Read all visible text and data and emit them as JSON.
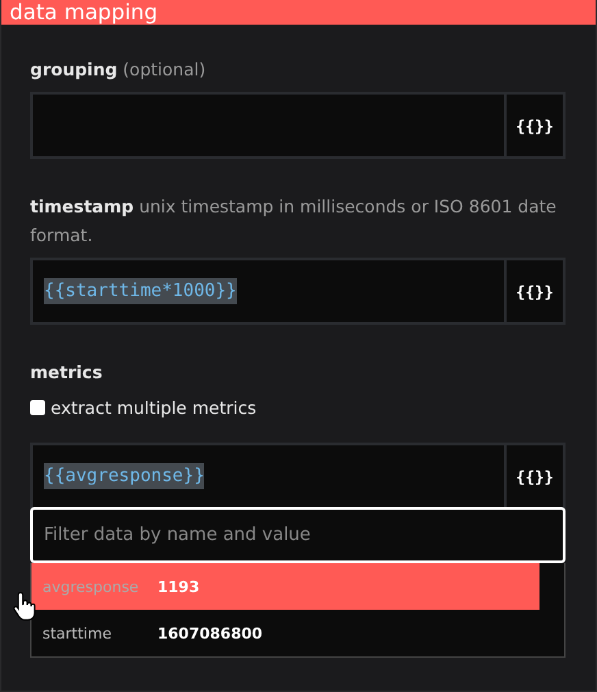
{
  "header": {
    "title": "data mapping"
  },
  "fields": [
    {
      "label": "grouping",
      "hint": "(optional)",
      "button": "{{}}"
    },
    {
      "label": "timestamp",
      "hint": "unix timestamp in milliseconds or ISO 8601 date format.",
      "value": "{{starttime*1000}}",
      "button": "{{}}"
    },
    {
      "label": "metrics",
      "checkbox": {
        "label": "extract multiple metrics",
        "checked": false
      },
      "value": "{{avgresponse}}",
      "button": "{{}}"
    }
  ],
  "dropdown": {
    "placeholder": "Filter data by name and value",
    "items": [
      {
        "name": "avgresponse",
        "value": "1193",
        "selected": true
      },
      {
        "name": "starttime",
        "value": "1607086800",
        "selected": false
      }
    ]
  }
}
